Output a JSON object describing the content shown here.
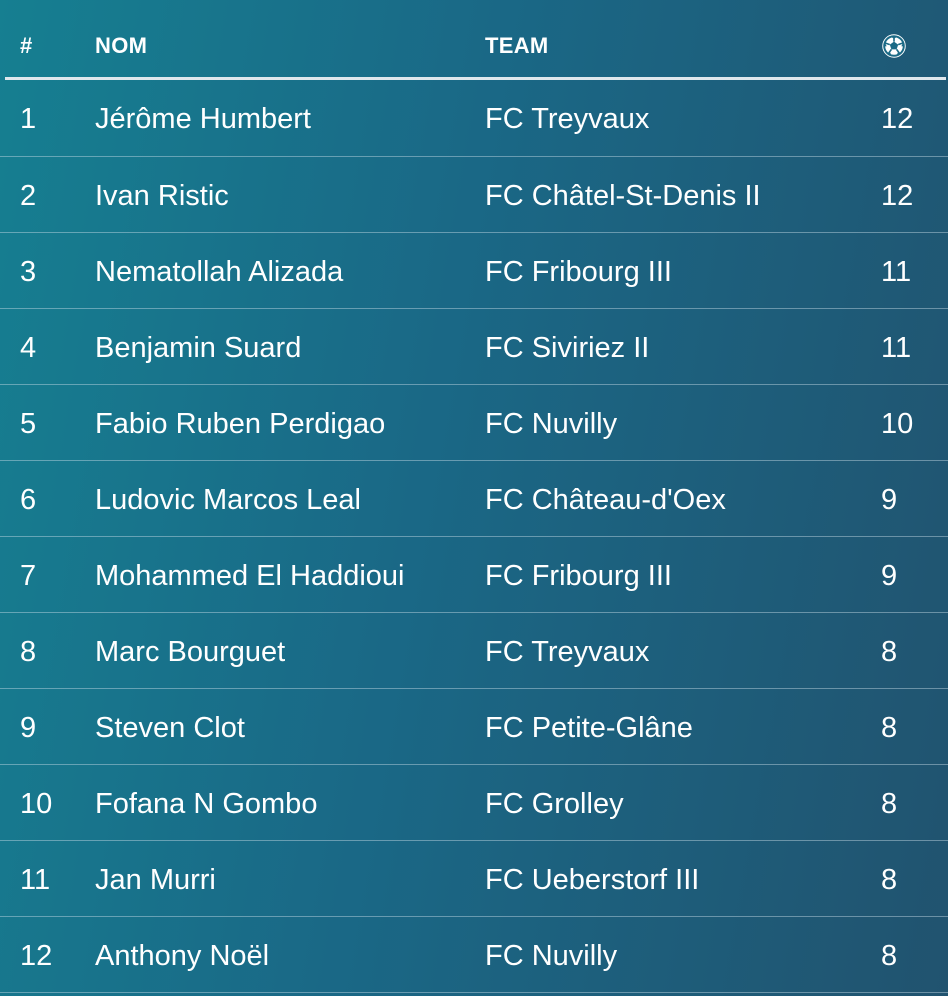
{
  "header": {
    "rank_label": "#",
    "name_label": "NOM",
    "team_label": "TEAM",
    "goals_icon": "soccer-ball-icon"
  },
  "rows": [
    {
      "rank": "1",
      "name": "Jérôme Humbert",
      "team": "FC Treyvaux",
      "goals": "12"
    },
    {
      "rank": "2",
      "name": "Ivan Ristic",
      "team": "FC Châtel-St-Denis II",
      "goals": "12"
    },
    {
      "rank": "3",
      "name": "Nematollah Alizada",
      "team": "FC Fribourg III",
      "goals": "11"
    },
    {
      "rank": "4",
      "name": "Benjamin Suard",
      "team": "FC Siviriez II",
      "goals": "11"
    },
    {
      "rank": "5",
      "name": "Fabio Ruben Perdigao",
      "team": "FC Nuvilly",
      "goals": "10"
    },
    {
      "rank": "6",
      "name": "Ludovic Marcos Leal",
      "team": "FC Château-d'Oex",
      "goals": "9"
    },
    {
      "rank": "7",
      "name": "Mohammed El Haddioui",
      "team": "FC Fribourg III",
      "goals": "9"
    },
    {
      "rank": "8",
      "name": "Marc Bourguet",
      "team": "FC Treyvaux",
      "goals": "8"
    },
    {
      "rank": "9",
      "name": "Steven Clot",
      "team": "FC Petite-Glâne",
      "goals": "8"
    },
    {
      "rank": "10",
      "name": "Fofana N Gombo",
      "team": "FC Grolley",
      "goals": "8"
    },
    {
      "rank": "11",
      "name": "Jan Murri",
      "team": "FC Ueberstorf III",
      "goals": "8"
    },
    {
      "rank": "12",
      "name": "Anthony Noël",
      "team": "FC Nuvilly",
      "goals": "8"
    }
  ]
}
